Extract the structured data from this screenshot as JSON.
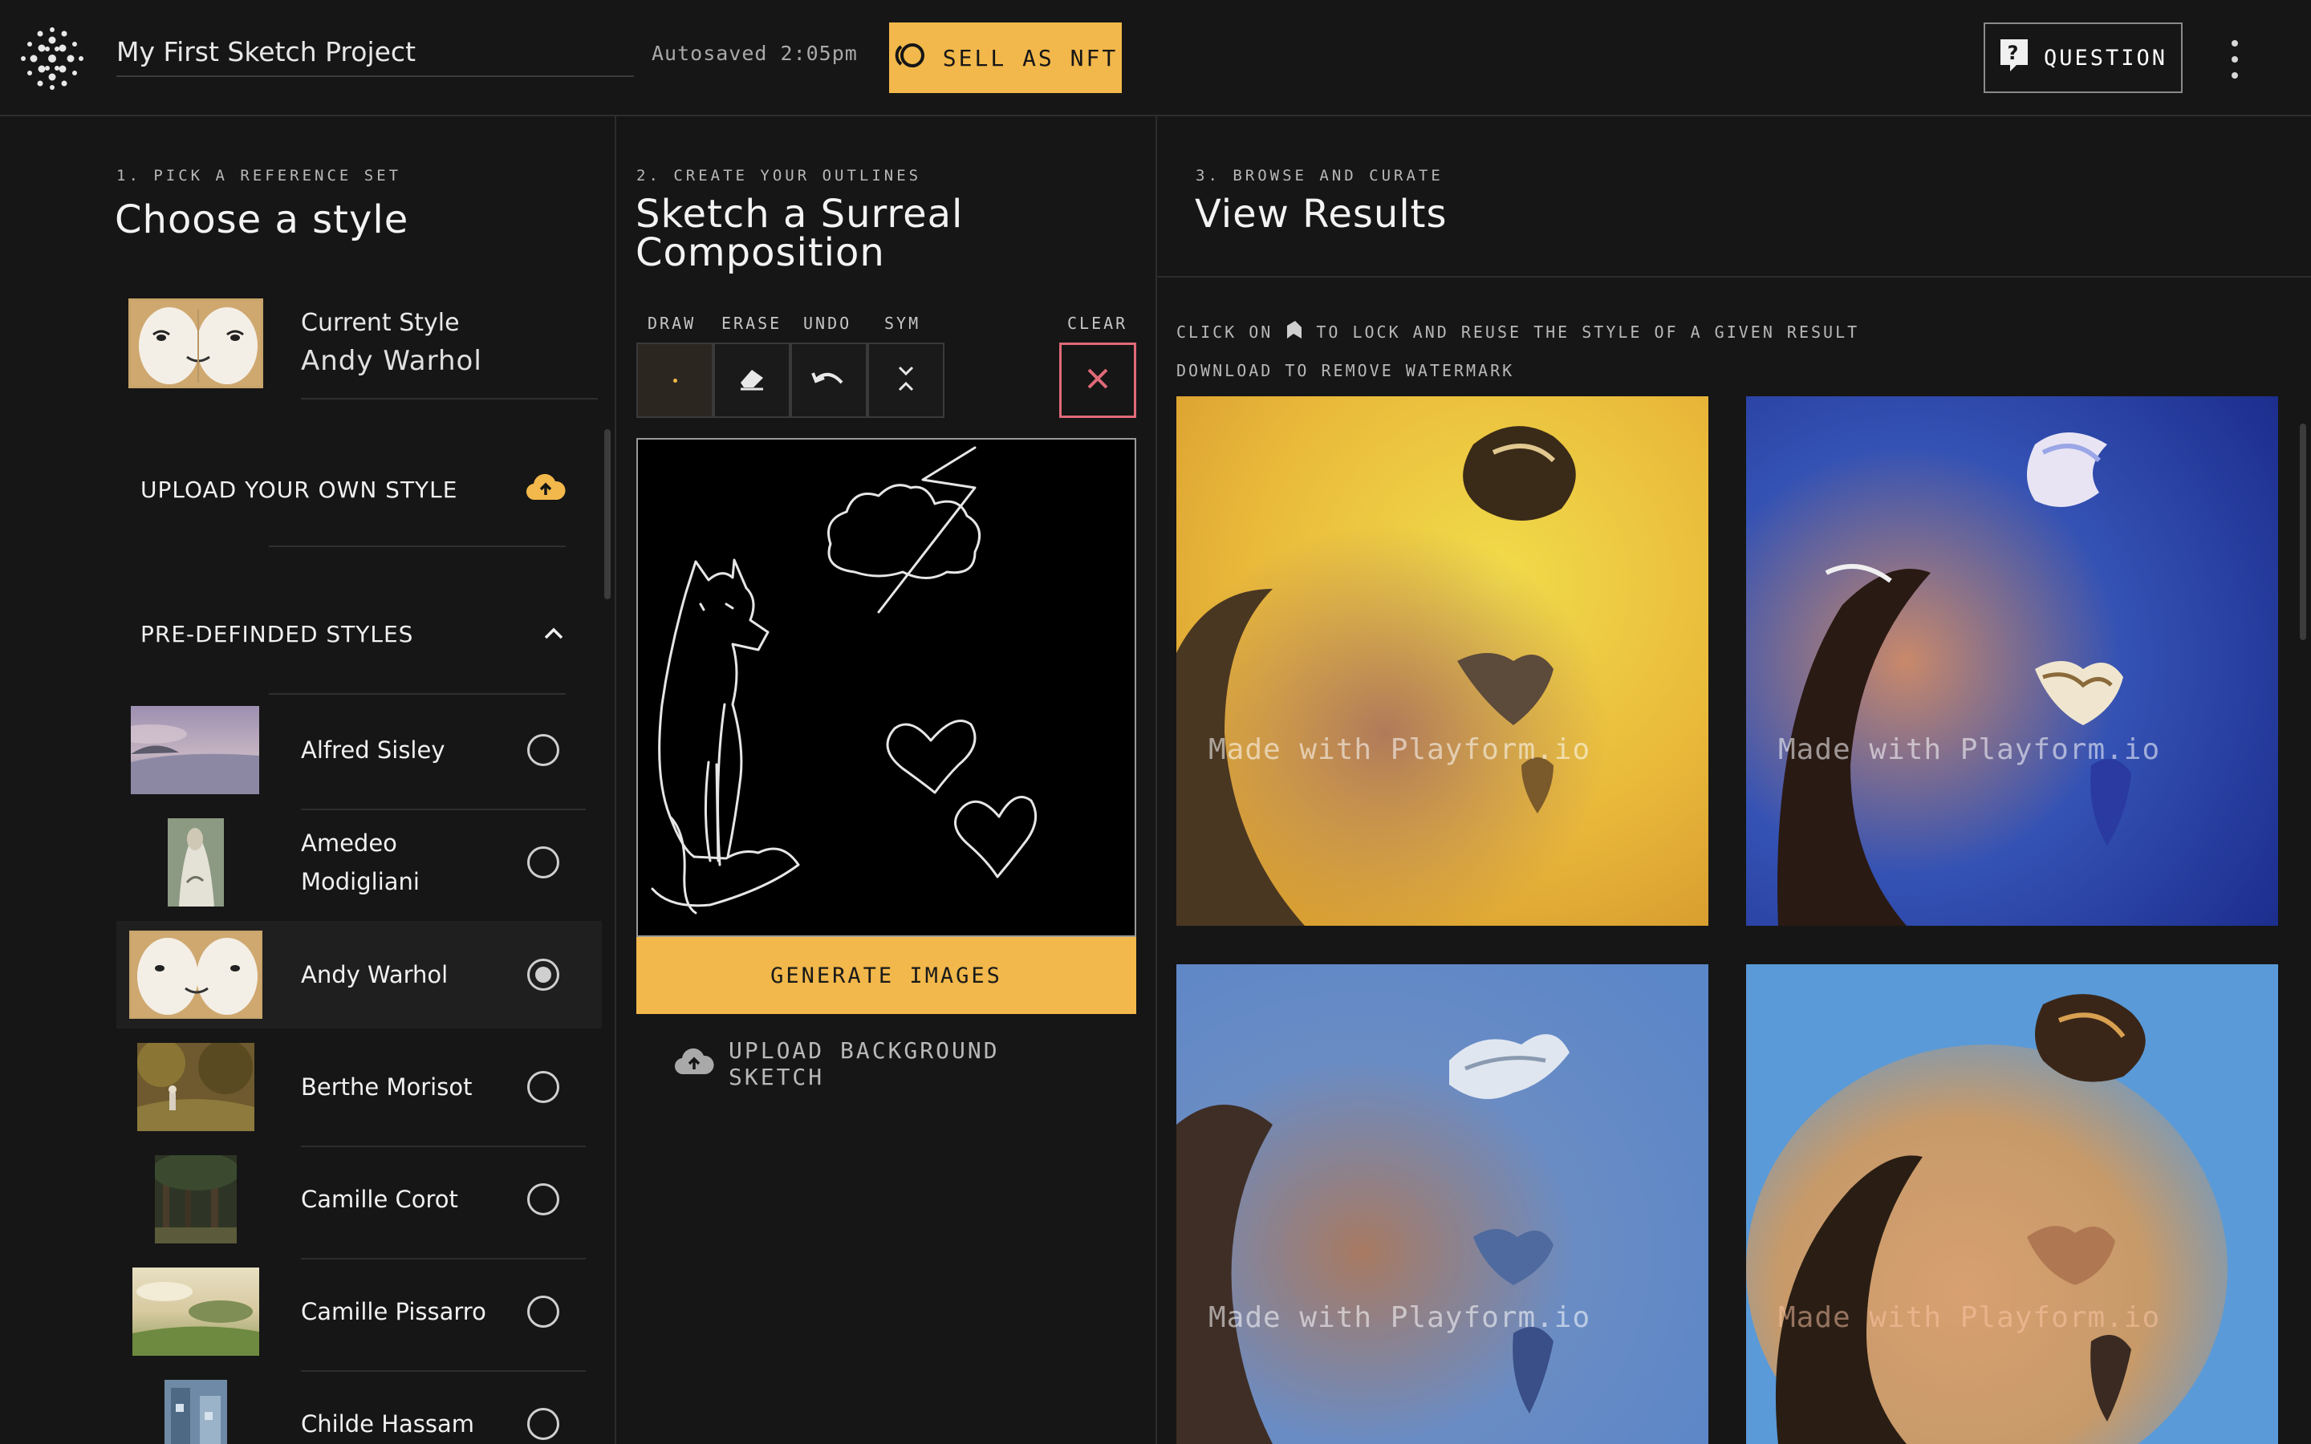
{
  "header": {
    "project_title": "My First Sketch Project",
    "autosave_status": "Autosaved 2:05pm",
    "sell_nft_label": "SELL AS NFT",
    "question_label": "QUESTION"
  },
  "colors": {
    "accent": "#f2b84b",
    "background": "#161616",
    "clear_border": "#e06a78"
  },
  "styles_panel": {
    "step_label": "1. PICK A REFERENCE SET",
    "title": "Choose a style",
    "current_style_label": "Current Style",
    "current_style_name": "Andy Warhol",
    "upload_label": "UPLOAD YOUR OWN STYLE",
    "predefined_label": "PRE-DEFINDED STYLES",
    "items": [
      {
        "name": "Alfred Sisley",
        "selected": false
      },
      {
        "name": "Amedeo Modigliani",
        "selected": false
      },
      {
        "name": "Andy Warhol",
        "selected": true
      },
      {
        "name": "Berthe Morisot",
        "selected": false
      },
      {
        "name": "Camille Corot",
        "selected": false
      },
      {
        "name": "Camille Pissarro",
        "selected": false
      },
      {
        "name": "Childe Hassam",
        "selected": false
      }
    ]
  },
  "sketch_panel": {
    "step_label": "2. CREATE YOUR OUTLINES",
    "title": "Sketch a Surreal Composition",
    "tools": {
      "draw": "DRAW",
      "erase": "ERASE",
      "undo": "UNDO",
      "sym": "SYM",
      "clear": "CLEAR"
    },
    "generate_label": "GENERATE IMAGES",
    "upload_background_label": "UPLOAD BACKGROUND SKETCH"
  },
  "results_panel": {
    "step_label": "3. BROWSE AND CURATE",
    "title": "View Results",
    "hint_lock_prefix": "CLICK ON",
    "hint_lock_suffix": "TO LOCK AND REUSE THE STYLE OF A GIVEN RESULT",
    "hint_download": "DOWNLOAD TO REMOVE WATERMARK",
    "watermark": "Made with Playform.io",
    "results": [
      {
        "palette": "yellow"
      },
      {
        "palette": "deep-blue"
      },
      {
        "palette": "sky-blue"
      },
      {
        "palette": "blue-gold"
      }
    ]
  },
  "icons": {
    "logo": "dot-grid-logo-icon",
    "sell_nft": "nft-ring-icon",
    "question": "question-bubble-icon",
    "more": "vertical-dots-icon",
    "upload": "cloud-upload-icon",
    "collapse": "chevron-up-icon",
    "lock": "bookmark-lock-icon"
  }
}
